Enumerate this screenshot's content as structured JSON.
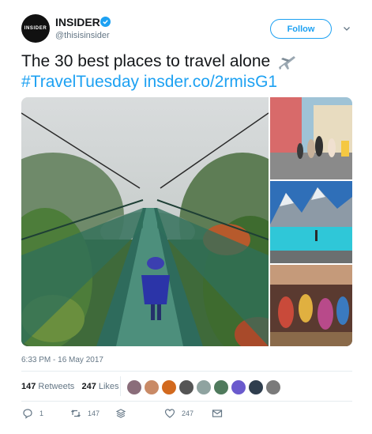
{
  "account": {
    "display_name": "INSIDER",
    "handle": "@thisisinsider",
    "avatar_text": "INSIDER",
    "verified_color": "#1da1f2"
  },
  "follow_button": {
    "label": "Follow"
  },
  "tweet": {
    "text": "The 30 best places to travel alone",
    "emoji": "airplane-icon",
    "hashtag": "#TravelTuesday",
    "link": "insder.co/2rmisG1"
  },
  "media": {
    "images": [
      {
        "name": "suspension-bridge-photo"
      },
      {
        "name": "street-walkers-photo"
      },
      {
        "name": "mountain-lake-photo"
      },
      {
        "name": "market-photo"
      }
    ]
  },
  "timestamp": "6:33 PM - 16 May 2017",
  "stats": {
    "retweets_count": "147",
    "retweets_label": "Retweets",
    "likes_count": "247",
    "likes_label": "Likes",
    "liker_avatar_colors": [
      "#8a6d7a",
      "#c98a66",
      "#d2691e",
      "#555555",
      "#8fa3a0",
      "#4f7a5c",
      "#6a5acd",
      "#2f3e4e",
      "#7a7a7a"
    ]
  },
  "actions": {
    "reply_count": "1",
    "retweet_count": "147",
    "like_count": "247"
  },
  "colors": {
    "accent": "#1da1f2",
    "secondary_text": "#657786",
    "divider": "#e6ecf0"
  }
}
